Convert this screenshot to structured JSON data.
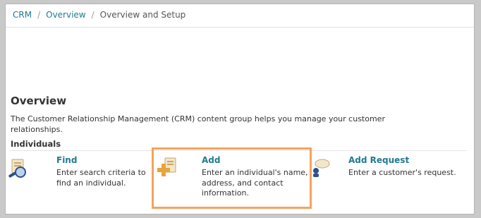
{
  "breadcrumb": {
    "items": [
      "CRM",
      "Overview"
    ],
    "current": "Overview and Setup",
    "separator": "/"
  },
  "page": {
    "title": "Overview",
    "description": "The Customer Relationship Management (CRM) content group helps you manage your customer relationships."
  },
  "section": {
    "title": "Individuals"
  },
  "actions": [
    {
      "title": "Find",
      "description": "Enter search criteria to find an individual.",
      "icon": "find-individual-icon"
    },
    {
      "title": "Add",
      "description": "Enter an individual's name, address, and contact information.",
      "icon": "add-individual-icon"
    },
    {
      "title": "Add Request",
      "description": "Enter a customer's request.",
      "icon": "add-request-icon"
    }
  ],
  "colors": {
    "link": "#1e7a8f",
    "highlight": "#f5a35b"
  }
}
